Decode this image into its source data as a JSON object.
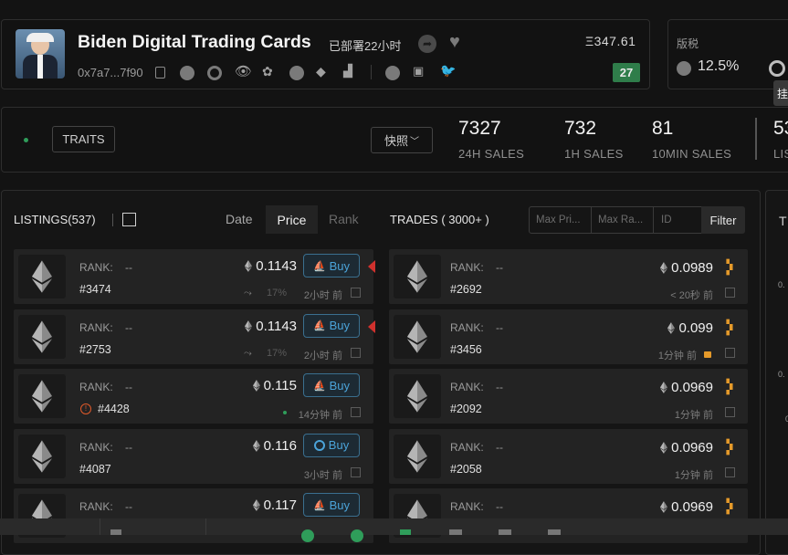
{
  "collection": {
    "name": "Biden Digital Trading Cards",
    "deployed": "已部署22小时",
    "address": "0x7a7...7f90",
    "floor_price": "Ξ347.61",
    "badge": "27"
  },
  "royalty": {
    "label": "版税",
    "value": "12.5%",
    "tooltip": "挂"
  },
  "stats_bar": {
    "traits_label": "TRAITS",
    "snapshot_label": "快照",
    "stats": [
      {
        "value": "7327",
        "label": "24H SALES"
      },
      {
        "value": "732",
        "label": "1H SALES"
      },
      {
        "value": "81",
        "label": "10MIN SALES"
      },
      {
        "value": "53",
        "label": "LIS"
      }
    ]
  },
  "listings": {
    "title": "LISTINGS(537)",
    "sort_tabs": [
      "Date",
      "Price",
      "Rank"
    ],
    "active_sort": "Price",
    "rows": [
      {
        "rank_label": "RANK:",
        "rank": "--",
        "id": "#3474",
        "price": "0.1143",
        "action": "Buy",
        "pct": "17%",
        "time": "2小时 前"
      },
      {
        "rank_label": "RANK:",
        "rank": "--",
        "id": "#2753",
        "price": "0.1143",
        "action": "Buy",
        "pct": "17%",
        "time": "2小时 前"
      },
      {
        "rank_label": "RANK:",
        "rank": "--",
        "id": "#4428",
        "price": "0.115",
        "action": "Buy",
        "pct": "",
        "time": "14分钟 前"
      },
      {
        "rank_label": "RANK:",
        "rank": "--",
        "id": "#4087",
        "price": "0.116",
        "action": "Buy",
        "pct": "",
        "time": "3小时 前"
      },
      {
        "rank_label": "RANK:",
        "rank": "--",
        "id": "",
        "price": "0.117",
        "action": "Buy",
        "pct": "",
        "time": ""
      }
    ]
  },
  "trades": {
    "title": "TRADES ( 3000+ )",
    "filter_placeholders": {
      "max_price": "Max Pri...",
      "max_rank": "Max Ra...",
      "id": "ID"
    },
    "filter_label": "Filter",
    "rows": [
      {
        "rank_label": "RANK:",
        "rank": "--",
        "id": "#2692",
        "price": "0.0989",
        "time": "< 20秒 前"
      },
      {
        "rank_label": "RANK:",
        "rank": "--",
        "id": "#3456",
        "price": "0.099",
        "time": "1分钟 前"
      },
      {
        "rank_label": "RANK:",
        "rank": "--",
        "id": "#2092",
        "price": "0.0969",
        "time": "1分钟 前"
      },
      {
        "rank_label": "RANK:",
        "rank": "--",
        "id": "#2058",
        "price": "0.0969",
        "time": "1分钟 前"
      },
      {
        "rank_label": "RANK:",
        "rank": "--",
        "id": "",
        "price": "0.0969",
        "time": ""
      }
    ]
  },
  "right_panel": {
    "header": "T",
    "ticks": [
      "0.",
      "0.",
      "0"
    ]
  },
  "colors": {
    "accent_green": "#2f7d4a",
    "buy_blue": "#4ba3d8",
    "alert_red": "#d0312d",
    "tag_orange": "#e59a2a"
  }
}
